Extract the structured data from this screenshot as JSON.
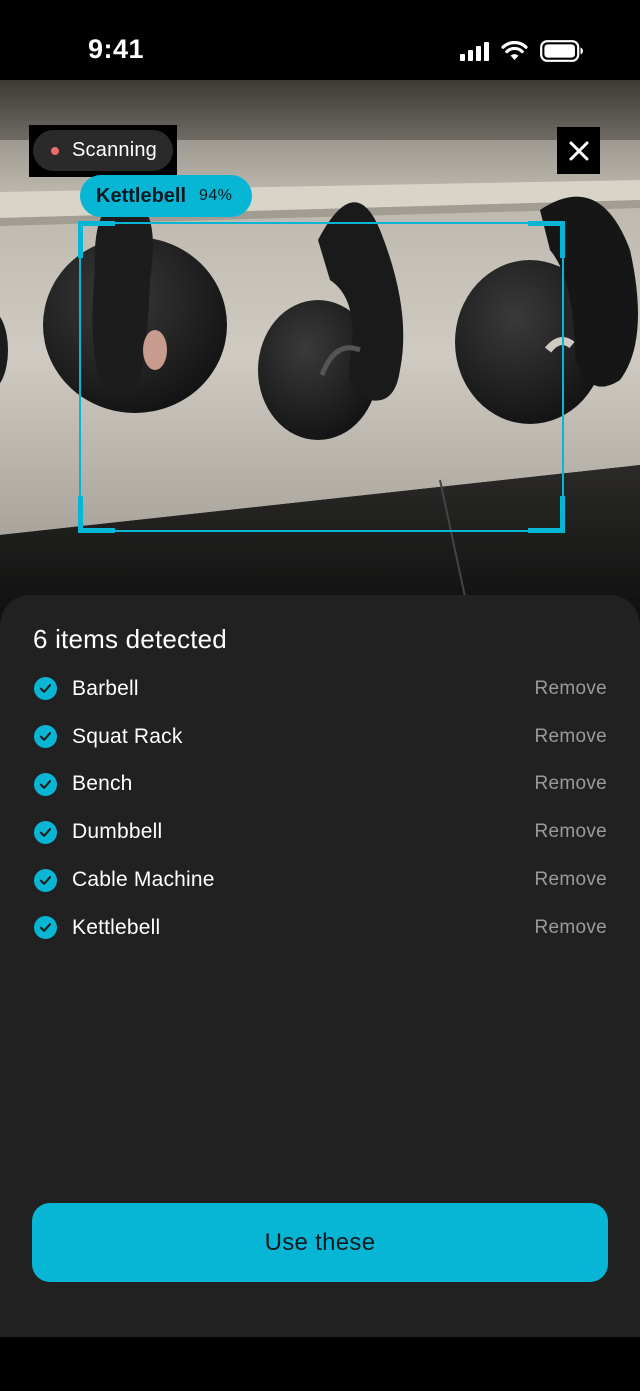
{
  "status_bar": {
    "time": "9:41",
    "icons": [
      "cellular-signal-icon",
      "wifi-icon",
      "battery-icon"
    ]
  },
  "camera": {
    "scanning_label": "Scanning",
    "close_icon": "close-icon",
    "detection": {
      "label": "Kettlebell",
      "confidence": "94%"
    }
  },
  "sheet": {
    "title": "6 items detected",
    "remove_label": "Remove",
    "items": [
      {
        "label": "Barbell"
      },
      {
        "label": "Squat Rack"
      },
      {
        "label": "Bench"
      },
      {
        "label": "Dumbbell"
      },
      {
        "label": "Cable Machine"
      },
      {
        "label": "Kettlebell"
      }
    ],
    "primary_button": "Use these"
  },
  "colors": {
    "accent": "#07b6d5",
    "sheet_background": "#212121",
    "recording_dot": "#ef6b6b",
    "muted_text": "#9a9a9a"
  }
}
